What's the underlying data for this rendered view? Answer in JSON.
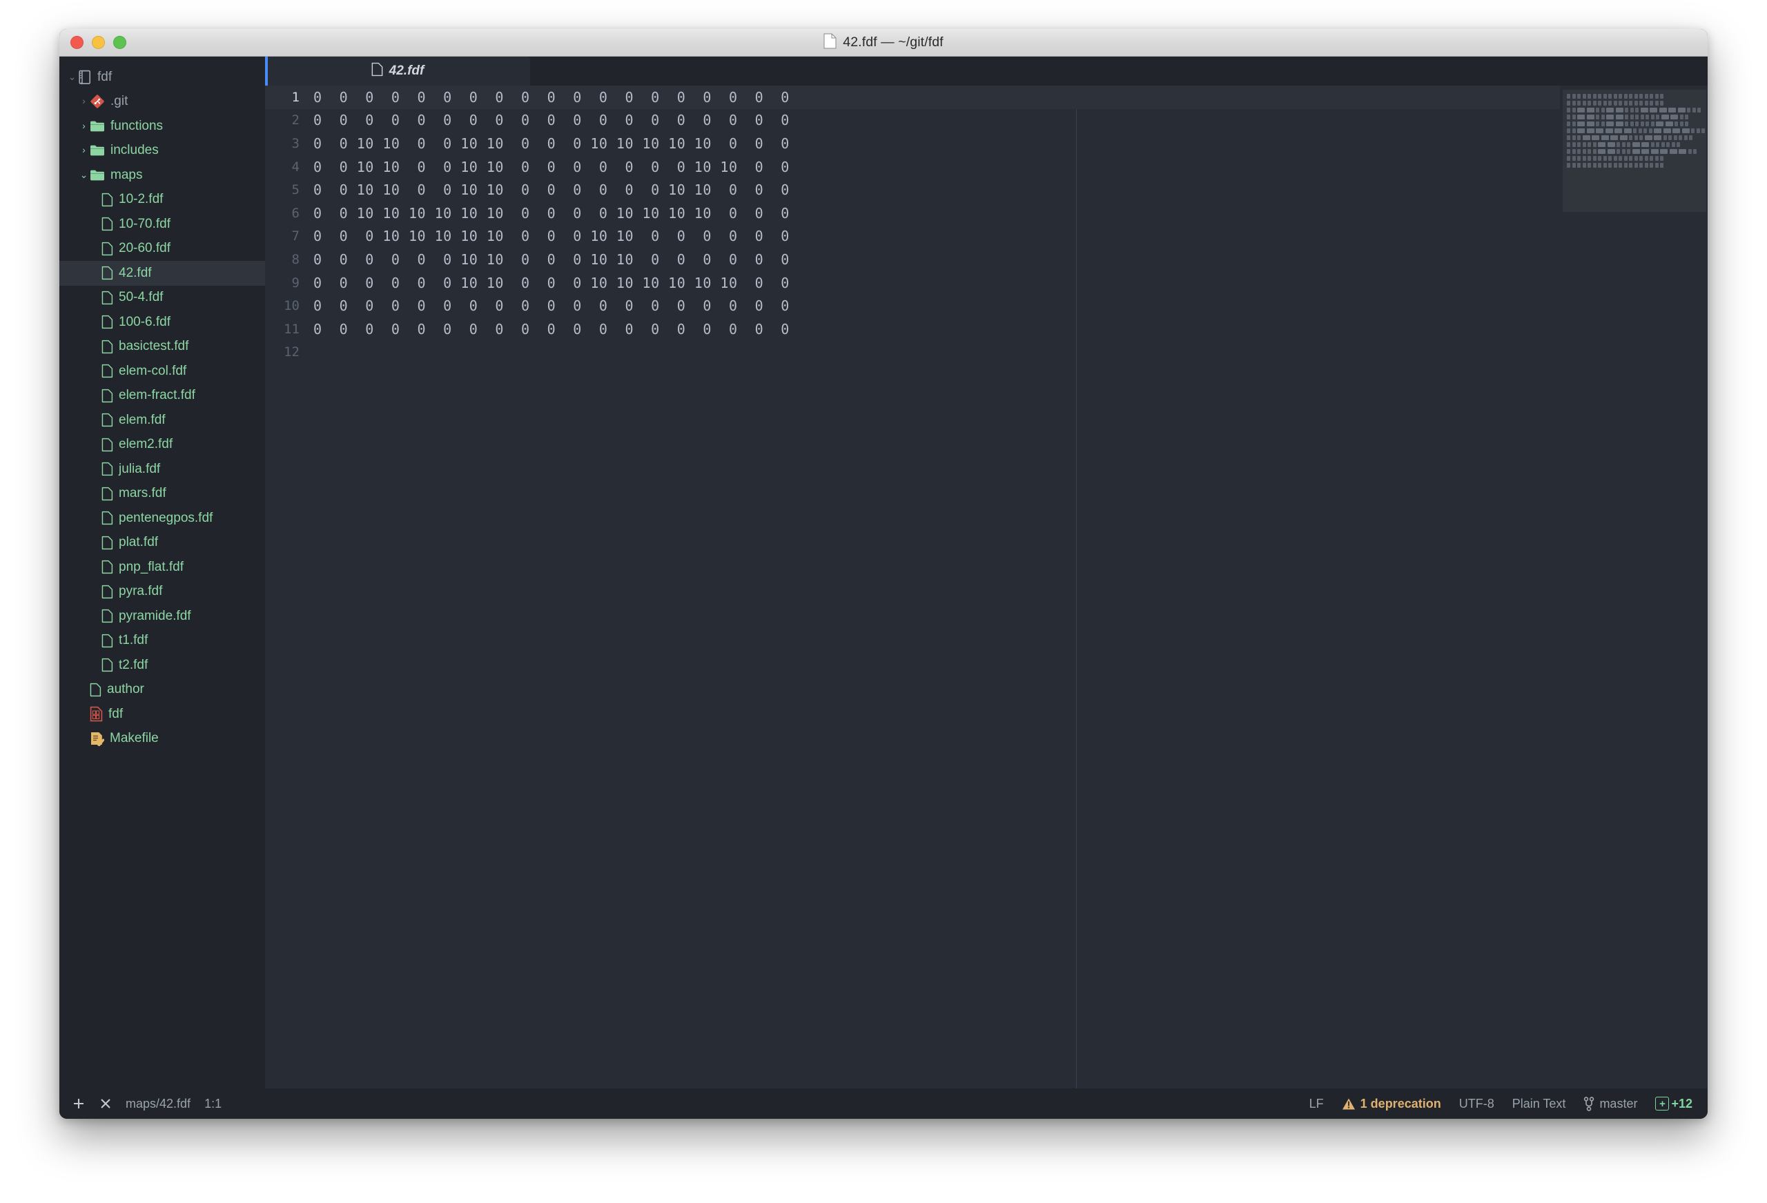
{
  "window": {
    "title": "42.fdf — ~/git/fdf",
    "title_icon": "file-icon",
    "traffic_lights": [
      "close-button",
      "minimize-button",
      "zoom-button"
    ]
  },
  "sidebar": {
    "items": [
      {
        "label": "fdf",
        "icon": "repo-book-icon",
        "depth": 0,
        "twisty": "open",
        "kind": "root",
        "selected": false
      },
      {
        "label": ".git",
        "icon": "git-diamond-icon",
        "depth": 1,
        "twisty": "closed",
        "kind": "folder-hidden",
        "selected": false
      },
      {
        "label": "functions",
        "icon": "folder-icon",
        "depth": 1,
        "twisty": "closed",
        "kind": "folder",
        "selected": false
      },
      {
        "label": "includes",
        "icon": "folder-icon",
        "depth": 1,
        "twisty": "closed",
        "kind": "folder",
        "selected": false
      },
      {
        "label": "maps",
        "icon": "folder-icon",
        "depth": 1,
        "twisty": "open",
        "kind": "folder",
        "selected": false
      },
      {
        "label": "10-2.fdf",
        "icon": "file-icon",
        "depth": 2,
        "twisty": "none",
        "kind": "file",
        "selected": false
      },
      {
        "label": "10-70.fdf",
        "icon": "file-icon",
        "depth": 2,
        "twisty": "none",
        "kind": "file",
        "selected": false
      },
      {
        "label": "20-60.fdf",
        "icon": "file-icon",
        "depth": 2,
        "twisty": "none",
        "kind": "file",
        "selected": false
      },
      {
        "label": "42.fdf",
        "icon": "file-icon",
        "depth": 2,
        "twisty": "none",
        "kind": "file",
        "selected": true
      },
      {
        "label": "50-4.fdf",
        "icon": "file-icon",
        "depth": 2,
        "twisty": "none",
        "kind": "file",
        "selected": false
      },
      {
        "label": "100-6.fdf",
        "icon": "file-icon",
        "depth": 2,
        "twisty": "none",
        "kind": "file",
        "selected": false
      },
      {
        "label": "basictest.fdf",
        "icon": "file-icon",
        "depth": 2,
        "twisty": "none",
        "kind": "file",
        "selected": false
      },
      {
        "label": "elem-col.fdf",
        "icon": "file-icon",
        "depth": 2,
        "twisty": "none",
        "kind": "file",
        "selected": false
      },
      {
        "label": "elem-fract.fdf",
        "icon": "file-icon",
        "depth": 2,
        "twisty": "none",
        "kind": "file",
        "selected": false
      },
      {
        "label": "elem.fdf",
        "icon": "file-icon",
        "depth": 2,
        "twisty": "none",
        "kind": "file",
        "selected": false
      },
      {
        "label": "elem2.fdf",
        "icon": "file-icon",
        "depth": 2,
        "twisty": "none",
        "kind": "file",
        "selected": false
      },
      {
        "label": "julia.fdf",
        "icon": "file-icon",
        "depth": 2,
        "twisty": "none",
        "kind": "file",
        "selected": false
      },
      {
        "label": "mars.fdf",
        "icon": "file-icon",
        "depth": 2,
        "twisty": "none",
        "kind": "file",
        "selected": false
      },
      {
        "label": "pentenegpos.fdf",
        "icon": "file-icon",
        "depth": 2,
        "twisty": "none",
        "kind": "file",
        "selected": false
      },
      {
        "label": "plat.fdf",
        "icon": "file-icon",
        "depth": 2,
        "twisty": "none",
        "kind": "file",
        "selected": false
      },
      {
        "label": "pnp_flat.fdf",
        "icon": "file-icon",
        "depth": 2,
        "twisty": "none",
        "kind": "file",
        "selected": false
      },
      {
        "label": "pyra.fdf",
        "icon": "file-icon",
        "depth": 2,
        "twisty": "none",
        "kind": "file",
        "selected": false
      },
      {
        "label": "pyramide.fdf",
        "icon": "file-icon",
        "depth": 2,
        "twisty": "none",
        "kind": "file",
        "selected": false
      },
      {
        "label": "t1.fdf",
        "icon": "file-icon",
        "depth": 2,
        "twisty": "none",
        "kind": "file",
        "selected": false
      },
      {
        "label": "t2.fdf",
        "icon": "file-icon",
        "depth": 2,
        "twisty": "none",
        "kind": "file",
        "selected": false
      },
      {
        "label": "author",
        "icon": "file-icon",
        "depth": 1,
        "twisty": "none",
        "kind": "file",
        "selected": false
      },
      {
        "label": "fdf",
        "icon": "binary-icon",
        "depth": 1,
        "twisty": "none",
        "kind": "binary",
        "selected": false
      },
      {
        "label": "Makefile",
        "icon": "makefile-icon",
        "depth": 1,
        "twisty": "none",
        "kind": "makefile",
        "selected": false
      }
    ]
  },
  "tabs": [
    {
      "label": "42.fdf",
      "icon": "file-icon",
      "active": true,
      "modified": true
    }
  ],
  "editor": {
    "active_line": 1,
    "lines": [
      "0  0  0  0  0  0  0  0  0  0  0  0  0  0  0  0  0  0  0",
      "0  0  0  0  0  0  0  0  0  0  0  0  0  0  0  0  0  0  0",
      "0  0 10 10  0  0 10 10  0  0  0 10 10 10 10 10  0  0  0",
      "0  0 10 10  0  0 10 10  0  0  0  0  0  0  0 10 10  0  0",
      "0  0 10 10  0  0 10 10  0  0  0  0  0  0 10 10  0  0  0",
      "0  0 10 10 10 10 10 10  0  0  0  0 10 10 10 10  0  0  0",
      "0  0  0 10 10 10 10 10  0  0  0 10 10  0  0  0  0  0  0",
      "0  0  0  0  0  0 10 10  0  0  0 10 10  0  0  0  0  0  0",
      "0  0  0  0  0  0 10 10  0  0  0 10 10 10 10 10 10  0  0",
      "0  0  0  0  0  0  0  0  0  0  0  0  0  0  0  0  0  0  0",
      "0  0  0  0  0  0  0  0  0  0  0  0  0  0  0  0  0  0  0",
      ""
    ],
    "line_numbers": [
      "1",
      "2",
      "3",
      "4",
      "5",
      "6",
      "7",
      "8",
      "9",
      "10",
      "11",
      "12"
    ]
  },
  "statusbar": {
    "add_icon": "plus-icon",
    "close_icon": "close-icon",
    "path": "maps/42.fdf",
    "cursor": "1:1",
    "line_ending": "LF",
    "warning_icon": "warning-triangle-icon",
    "warning": "1 deprecation",
    "encoding": "UTF-8",
    "grammar": "Plain Text",
    "branch_icon": "git-branch-icon",
    "branch": "master",
    "diff_icon": "plus-box-icon",
    "diff": "+12"
  },
  "colors": {
    "accent_blue": "#4a8cf7",
    "file_green": "#8dd6a3",
    "warning_amber": "#e0b170",
    "diff_green": "#7fd6a0",
    "git_red": "#d4564b",
    "makefile_orange": "#e5b76a",
    "sidebar_bg": "#21252b",
    "editor_bg": "#282c34"
  }
}
